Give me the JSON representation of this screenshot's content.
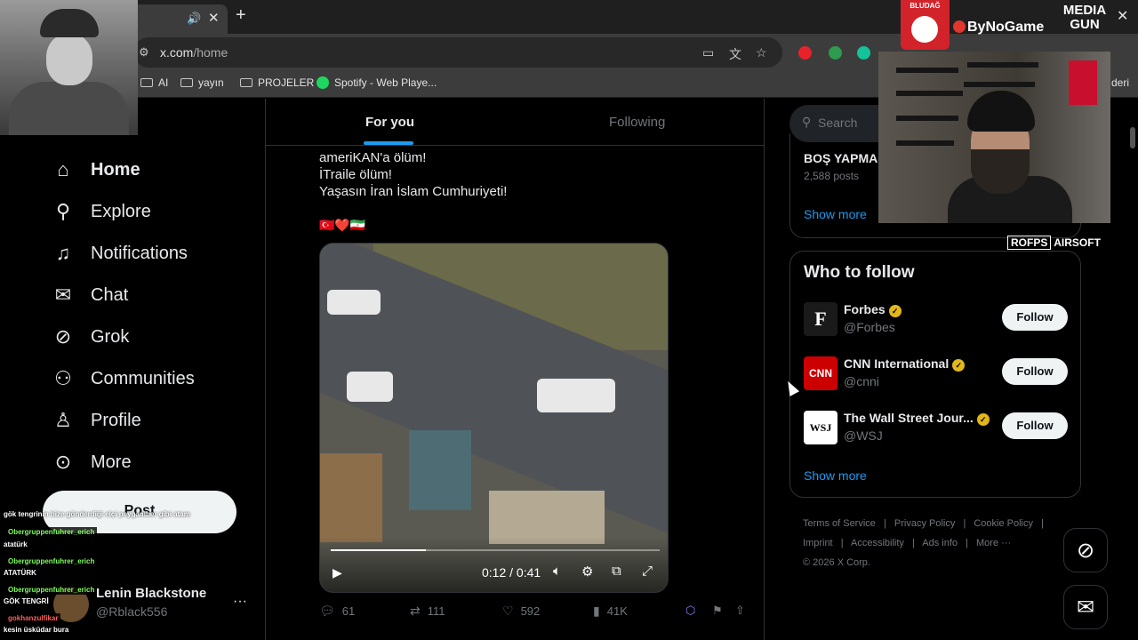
{
  "browser": {
    "tab_speaker": "🔊",
    "tab_close": "✕",
    "new_tab": "+",
    "url_host": "x.com",
    "url_path": "/home",
    "window_minimize": "–",
    "window_close": "✕",
    "bookmarks": [
      "AI",
      "yayın",
      "PROJELER",
      "Spotify - Web Playe..."
    ],
    "bookmark_overflow": "deri"
  },
  "overlays": {
    "sponsor_1": "BLUDAĞ",
    "sponsor_2": "ByNoGame",
    "sponsor_3_line1": "MEDIA",
    "sponsor_3_line2": "GUN",
    "sponsor_4a": "ROFPS",
    "sponsor_4b": "AIRSOFT"
  },
  "nav": {
    "items": [
      {
        "label": "Home",
        "icon": "home-icon"
      },
      {
        "label": "Explore",
        "icon": "search-icon"
      },
      {
        "label": "Notifications",
        "icon": "bell-icon"
      },
      {
        "label": "Chat",
        "icon": "mail-icon"
      },
      {
        "label": "Grok",
        "icon": "grok-icon"
      },
      {
        "label": "Communities",
        "icon": "people-icon"
      },
      {
        "label": "Profile",
        "icon": "user-icon"
      },
      {
        "label": "More",
        "icon": "more-circle-icon"
      }
    ],
    "post_label": "Post",
    "account_name": "Lenin Blackstone",
    "account_handle": "@Rblack556"
  },
  "chat": {
    "messages": [
      {
        "user": "",
        "text": "gök tengrinin bize gönderdiği elçi peygamber gibi atam"
      },
      {
        "user": "Obergruppenfuhrer_erich",
        "text": "atatürk"
      },
      {
        "user": "Obergruppenfuhrer_erich",
        "text": "ATATÜRK"
      },
      {
        "user": "Obergruppenfuhrer_erich",
        "text": "GÖK TENGRİ"
      },
      {
        "user": "gokhanzulfikar",
        "text": "kesin üsküdar bura"
      }
    ]
  },
  "feed": {
    "tab_for_you": "For you",
    "tab_following": "Following",
    "post_lines": [
      "ameriKAN'a ölüm!",
      "İTraile ölüm!",
      "Yaşasın İran İslam Cumhuriyeti!"
    ],
    "flags": "🇹🇷❤️🇮🇷",
    "video_time": "0:12 / 0:41",
    "video_progress": 0.29,
    "replies": "61",
    "reposts": "111",
    "likes": "592",
    "views": "41K"
  },
  "right": {
    "search_placeholder": "Search",
    "trend_name": "BOŞ YAPMA",
    "trend_count": "2,588 posts",
    "show_more": "Show more",
    "who_to_follow_title": "Who to follow",
    "follow_label": "Follow",
    "accounts": [
      {
        "name": "Forbes",
        "handle": "@Forbes",
        "avatar_text": "F"
      },
      {
        "name": "CNN International",
        "handle": "@cnni",
        "avatar_text": "CNN"
      },
      {
        "name": "The Wall Street Jour...",
        "handle": "@WSJ",
        "avatar_text": "WSJ"
      }
    ],
    "show_more_2": "Show more",
    "footer": [
      "Terms of Service",
      "|",
      "Privacy Policy",
      "|",
      "Cookie Policy",
      "|",
      "Imprint",
      "|",
      "Accessibility",
      "|",
      "Ads info",
      "|",
      "More ···",
      "© 2026 X Corp."
    ]
  },
  "colors": {
    "accent": "#1d9bf0",
    "background": "#000000",
    "verified": "#e2b719"
  }
}
